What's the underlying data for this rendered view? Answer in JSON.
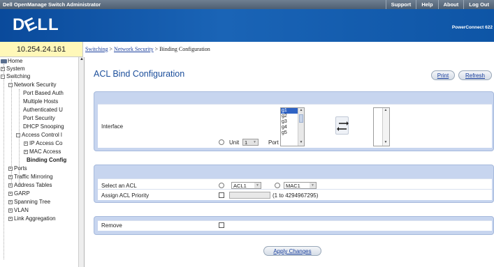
{
  "topbar": {
    "app_title": "Dell OpenManage Switch Administrator",
    "links": [
      "Support",
      "Help",
      "About",
      "Log Out"
    ]
  },
  "banner": {
    "logo": "DELL",
    "product": "PowerConnect 622"
  },
  "ip_address": "10.254.24.161",
  "breadcrumb": {
    "switching": "Switching",
    "sep1": " > ",
    "network_security": "Network Security",
    "sep2": " > ",
    "current": "Binding Configuration"
  },
  "tree": {
    "home": "Home",
    "system": "System",
    "switching": "Switching",
    "network_security": "Network Security",
    "port_based_auth": "Port Based Auth",
    "multiple_hosts": "Multiple Hosts",
    "authenticated_u": "Authenticated U",
    "port_security": "Port Security",
    "dhcp_snooping": "DHCP Snooping",
    "access_control": "Access Control l",
    "ip_access": "IP Access Co",
    "mac_access": "MAC Access",
    "binding_config": "Binding Config",
    "ports": "Ports",
    "traffic_mirroring": "Traffic Mirroring",
    "address_tables": "Address Tables",
    "garp": "GARP",
    "spanning_tree": "Spanning Tree",
    "vlan": "VLAN",
    "link_aggregation": "Link Aggregation"
  },
  "page": {
    "title": "ACL Bind Configuration",
    "print": "Print",
    "refresh": "Refresh",
    "apply": "Apply Changes"
  },
  "interface": {
    "label": "Interface",
    "unit_label": "Unit",
    "unit_value": "1",
    "port_label": "Port",
    "ports": [
      "g1",
      "g2",
      "g3",
      "g4",
      "g5"
    ],
    "selected_port": "g1"
  },
  "acl": {
    "select_label": "Select an ACL",
    "acl1": "ACL1",
    "mac1": "MAC1",
    "priority_label": "Assign ACL Priority",
    "priority_range": "(1 to 4294967295)"
  },
  "remove": {
    "label": "Remove"
  },
  "colors": {
    "banner": "#1a64b6",
    "panel": "#c7d5ef",
    "title": "#1b4e9b",
    "ip_bar": "#fff8b9"
  }
}
